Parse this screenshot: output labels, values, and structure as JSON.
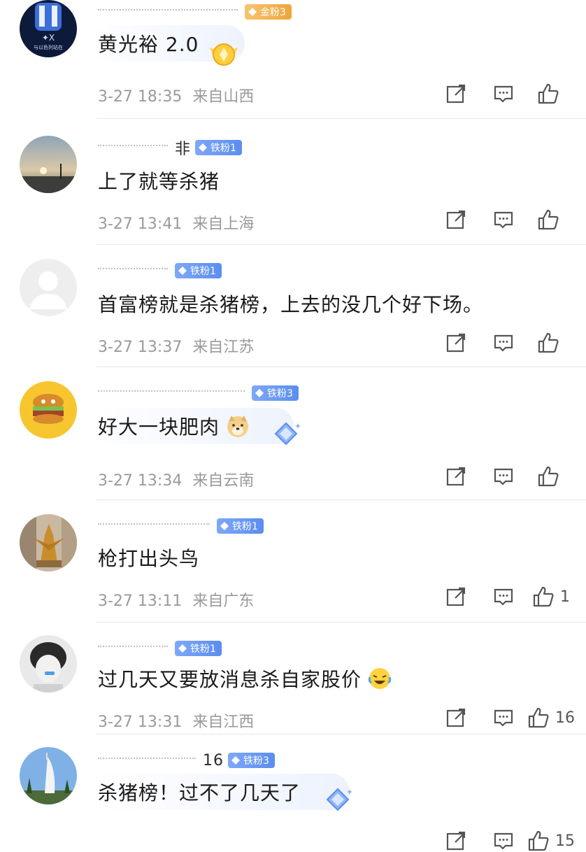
{
  "comments": [
    {
      "name_fragment": "",
      "badge": "金粉3",
      "badge_type": "gold",
      "text": "黄光裕 2.0",
      "time": "3-27 18:35",
      "location": "来自山西",
      "likes": ""
    },
    {
      "name_fragment": "非",
      "badge": "铁粉1",
      "badge_type": "iron",
      "text": "上了就等杀猪",
      "time": "3-27 13:41",
      "location": "来自上海",
      "likes": ""
    },
    {
      "name_fragment": "",
      "badge": "铁粉1",
      "badge_type": "iron",
      "text": "首富榜就是杀猪榜，上去的没几个好下场。",
      "time": "3-27 13:37",
      "location": "来自江苏",
      "likes": ""
    },
    {
      "name_fragment": "",
      "badge": "铁粉3",
      "badge_type": "iron",
      "text": "好大一块肥肉",
      "time": "3-27 13:34",
      "location": "来自云南",
      "likes": ""
    },
    {
      "name_fragment": "",
      "badge": "铁粉1",
      "badge_type": "iron",
      "text": "枪打出头鸟",
      "time": "3-27 13:11",
      "location": "来自广东",
      "likes": "1"
    },
    {
      "name_fragment": "",
      "badge": "铁粉1",
      "badge_type": "iron",
      "text": "过几天又要放消息杀自家股价",
      "time": "3-27 13:31",
      "location": "来自江西",
      "likes": "16"
    },
    {
      "name_fragment": "16",
      "badge": "铁粉3",
      "badge_type": "iron",
      "text": "杀猪榜！过不了几天了",
      "time": "",
      "location": "",
      "likes": "15"
    }
  ],
  "colors": {
    "badge_iron": "#6b9bf2",
    "badge_gold": "#f0ae45",
    "meta_text": "#9a9a9a",
    "divider": "#e6e6e6"
  },
  "icons": [
    "repost-icon",
    "comment-icon",
    "like-icon",
    "doge-emoji-icon",
    "laughing-crying-emoji-icon"
  ]
}
